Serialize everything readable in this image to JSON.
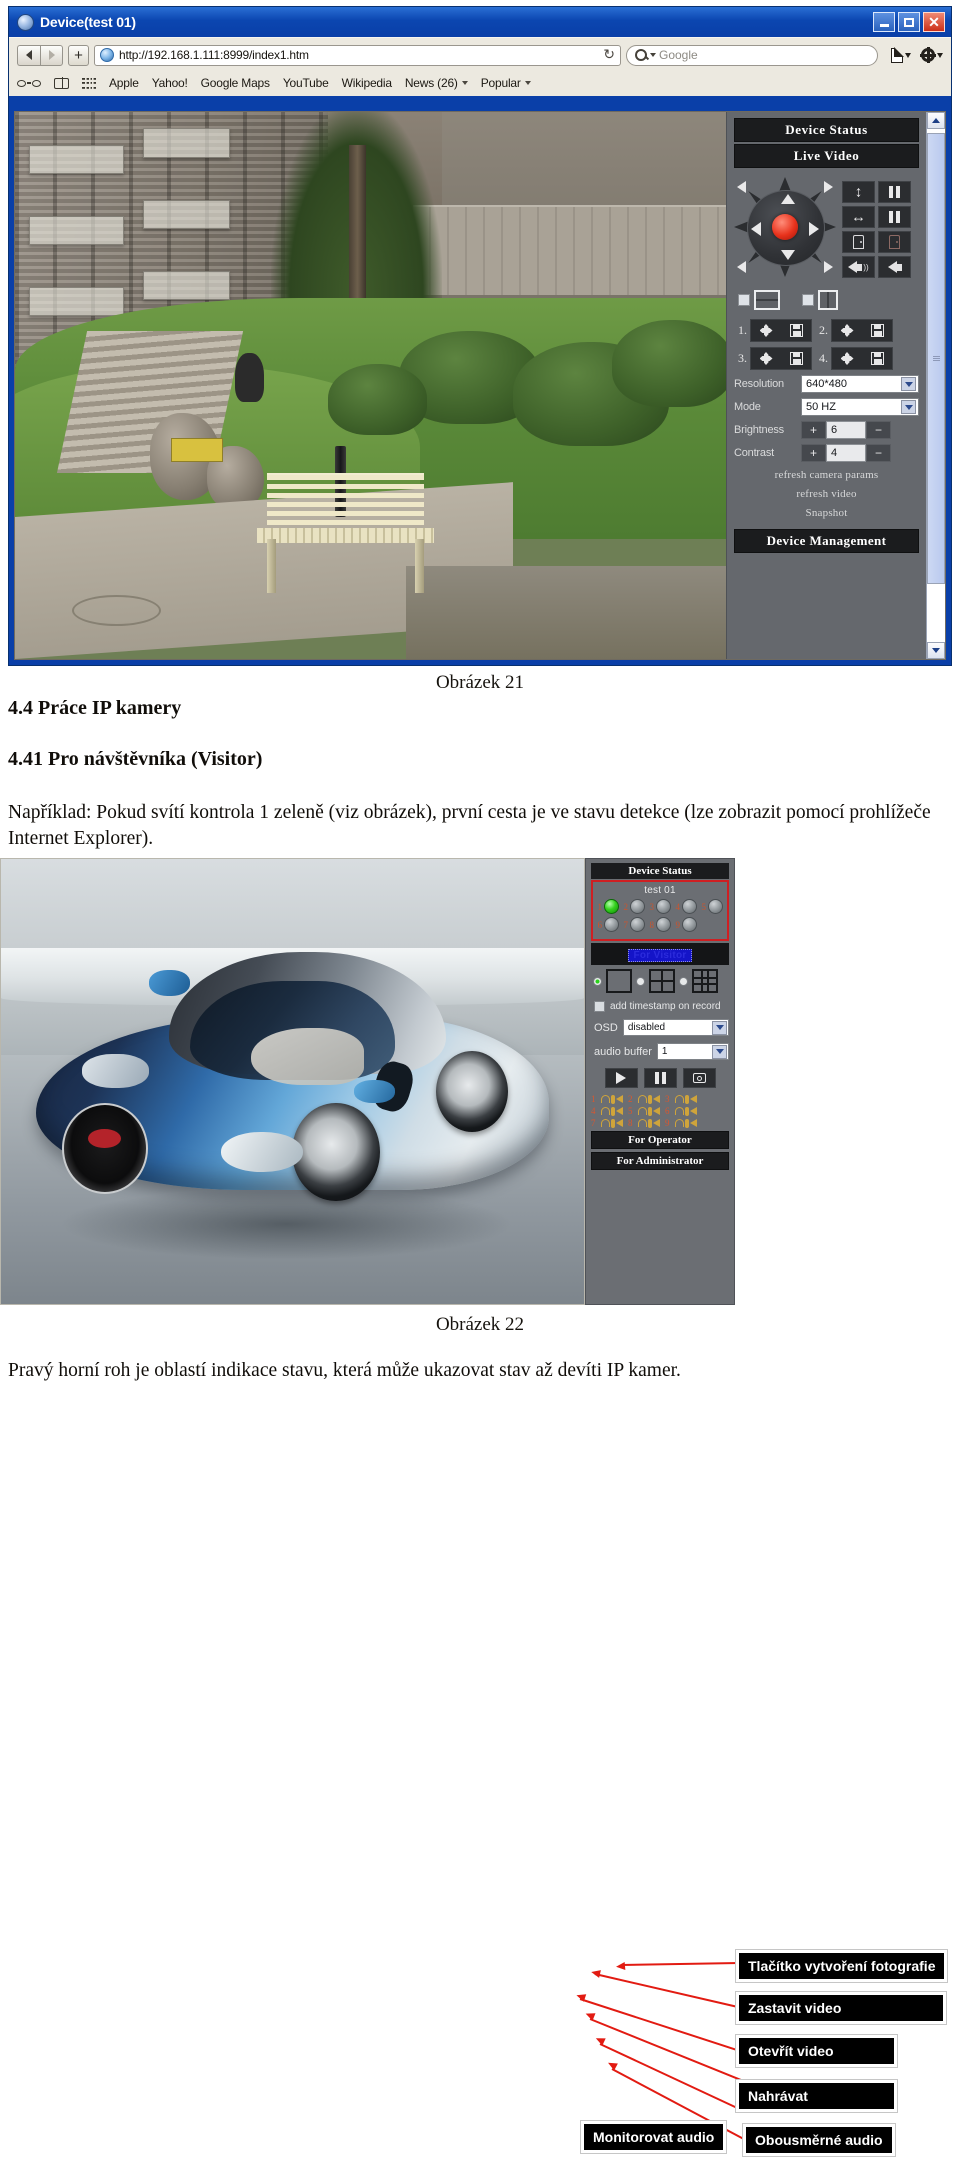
{
  "figure21": {
    "window_title": "Device(test 01)",
    "window_buttons": {
      "minimize": "_",
      "maximize": "□",
      "close": "✕"
    },
    "browser": {
      "url": "http://192.168.1.111:8999/index1.htm",
      "reload_icon": "↻",
      "search_placeholder": "Google",
      "add_tab_label": "+",
      "bookmarks": [
        {
          "label": "Apple",
          "has_dropdown": false
        },
        {
          "label": "Yahoo!",
          "has_dropdown": false
        },
        {
          "label": "Google Maps",
          "has_dropdown": false
        },
        {
          "label": "YouTube",
          "has_dropdown": false
        },
        {
          "label": "Wikipedia",
          "has_dropdown": false
        },
        {
          "label": "News (26)",
          "has_dropdown": true
        },
        {
          "label": "Popular",
          "has_dropdown": true
        }
      ]
    },
    "panel": {
      "device_status": "Device Status",
      "live_video": "Live Video",
      "function_buttons": [
        "vertical-scan",
        "pause-vertical",
        "horizontal-scan",
        "pause-horizontal",
        "io-on",
        "io-off",
        "alarm-on",
        "alarm-off"
      ],
      "toggles": [
        {
          "name": "horizontal-mirror"
        },
        {
          "name": "vertical-flip"
        }
      ],
      "presets": [
        {
          "number": "1."
        },
        {
          "number": "2."
        },
        {
          "number": "3."
        },
        {
          "number": "4."
        }
      ],
      "settings": [
        {
          "label": "Resolution",
          "type": "select",
          "value": "640*480"
        },
        {
          "label": "Mode",
          "type": "select",
          "value": "50 HZ"
        },
        {
          "label": "Brightness",
          "type": "spinner",
          "value": "6",
          "plus": "+",
          "minus": "−"
        },
        {
          "label": "Contrast",
          "type": "spinner",
          "value": "4",
          "plus": "+",
          "minus": "−"
        }
      ],
      "links": [
        "refresh camera params",
        "refresh video",
        "Snapshot"
      ],
      "device_management": "Device Management"
    }
  },
  "caption21": "Obrázek 21",
  "headings": {
    "h1": "4.4 Práce IP kamery",
    "h2": "4.41 Pro návštěvníka (Visitor)"
  },
  "paragraph": "Například: Pokud svítí kontrola 1 zeleně (viz obrázek), první cesta je ve stavu detekce (lze zobrazit pomocí prohlížeče Internet Explorer).",
  "figure22": {
    "panel": {
      "device_status": "Device Status",
      "device_name": "test 01",
      "leds": [
        {
          "num": "1",
          "state": "on"
        },
        {
          "num": "2",
          "state": "off"
        },
        {
          "num": "3",
          "state": "off"
        },
        {
          "num": "4",
          "state": "off"
        },
        {
          "num": "5",
          "state": "off"
        },
        {
          "num": "6",
          "state": "off"
        },
        {
          "num": "7",
          "state": "off"
        },
        {
          "num": "8",
          "state": "off"
        },
        {
          "num": "9",
          "state": "off"
        }
      ],
      "for_visitor": "For Visitor",
      "layouts": [
        {
          "name": "layout-1x1",
          "selected": true
        },
        {
          "name": "layout-2x2",
          "selected": false
        },
        {
          "name": "layout-3x3",
          "selected": false
        }
      ],
      "timestamp_label": "add timestamp on record",
      "settings": [
        {
          "label": "OSD",
          "value": "disabled"
        },
        {
          "label": "audio buffer",
          "value": "1"
        }
      ],
      "media_buttons": [
        "play",
        "pause",
        "snapshot"
      ],
      "audio_rows": [
        [
          "1",
          "2",
          "3"
        ],
        [
          "4",
          "5",
          "6"
        ],
        [
          "7",
          "8",
          "9"
        ]
      ],
      "for_operator": "For Operator",
      "for_administrator": "For Administrator"
    },
    "annotations": [
      {
        "label": "Tlačítko vytvoření fotografie"
      },
      {
        "label": "Zastavit video"
      },
      {
        "label": "Otevřít video"
      },
      {
        "label": "Nahrávat"
      },
      {
        "label": "Monitorovat audio"
      },
      {
        "label": "Obousměrné audio"
      }
    ]
  },
  "caption22": "Obrázek 22",
  "footer_text": "Pravý horní roh je oblastí indikace stavu, která může ukazovat stav až devíti IP kamer."
}
